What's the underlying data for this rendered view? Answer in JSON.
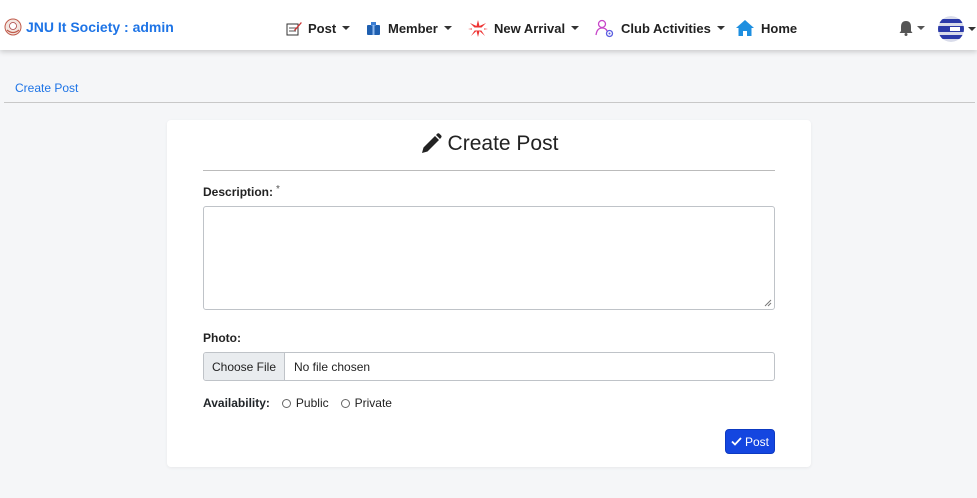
{
  "navbar": {
    "brand": "JNU It Society : admin",
    "items": [
      {
        "label": "Post",
        "icon": "pen-paper-icon",
        "has_dropdown": true
      },
      {
        "label": "Member",
        "icon": "member-icon",
        "has_dropdown": true
      },
      {
        "label": "New Arrival",
        "icon": "starburst-icon",
        "has_dropdown": true
      },
      {
        "label": "Club Activities",
        "icon": "people-gear-icon",
        "has_dropdown": true
      },
      {
        "label": "Home",
        "icon": "home-icon",
        "has_dropdown": false
      }
    ]
  },
  "breadcrumb": "Create Post",
  "form": {
    "title": "Create Post",
    "description_label": "Description:",
    "required_mark": "*",
    "description_value": "",
    "photo_label": "Photo:",
    "file_button": "Choose File",
    "file_status": "No file chosen",
    "availability_label": "Availability:",
    "availability_options": [
      "Public",
      "Private"
    ],
    "submit_label": "Post"
  },
  "colors": {
    "accent": "#1e74e6",
    "button": "#1446e0"
  }
}
